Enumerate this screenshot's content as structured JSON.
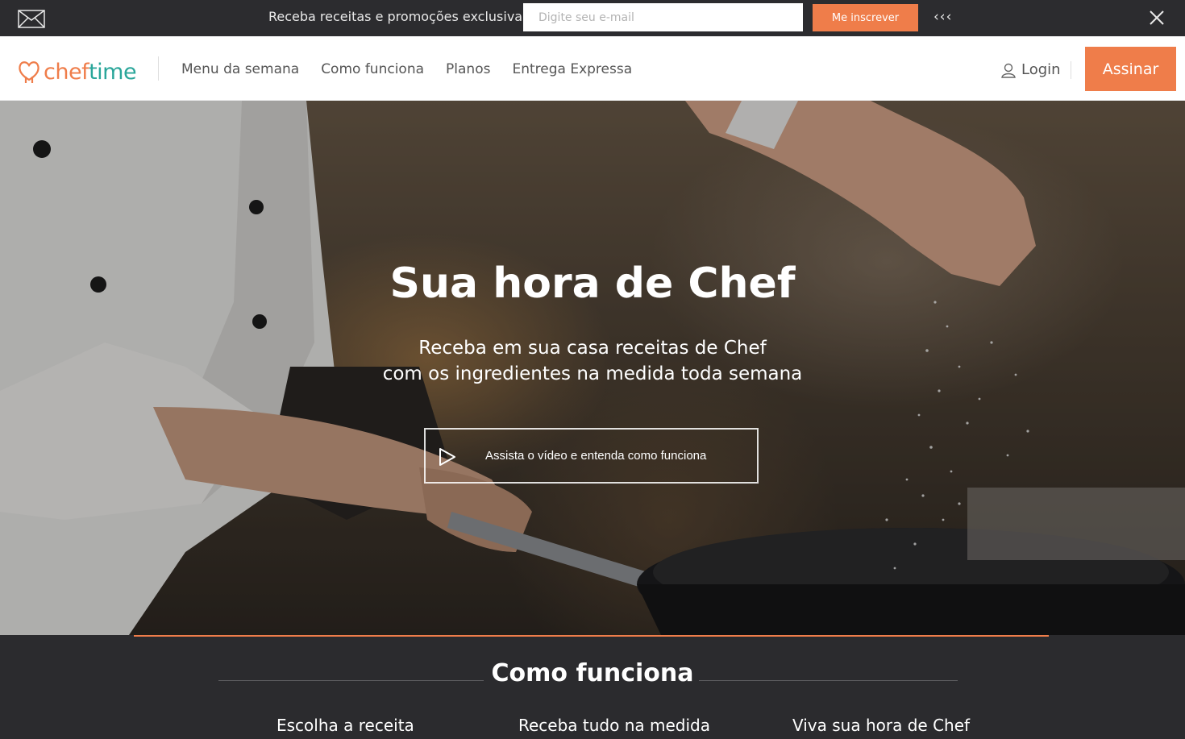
{
  "promo": {
    "icon": "envelope-icon",
    "text": "Receba receitas e promoções exclusivas",
    "email_placeholder": "Digite seu e-mail",
    "email_value": "",
    "subscribe_label": "Me inscrever",
    "collapse_label": "‹‹‹",
    "close_icon": "close-icon"
  },
  "header": {
    "logo": {
      "part1": "chef",
      "part2": "time",
      "icon": "chef-hat-heart-icon"
    },
    "nav": [
      "Menu da semana",
      "Como funciona",
      "Planos",
      "Entrega Expressa"
    ],
    "login_label": "Login",
    "login_icon": "user-icon",
    "cta_label": "Assinar"
  },
  "hero": {
    "title": "Sua hora de Chef",
    "subtitle_line1": "Receba em sua casa receitas de Chef",
    "subtitle_line2": "com os ingredientes na medida toda semana",
    "video_label": "Assista o vídeo e entenda como funciona",
    "video_icon": "play-icon"
  },
  "section": {
    "title": "Como funciona",
    "steps": [
      "Escolha a receita",
      "Receba tudo na medida",
      "Viva sua hora de Chef"
    ]
  },
  "colors": {
    "accent": "#ef7d4a",
    "logo_teal": "#2aa69a",
    "dark_bar": "#2c2c2f"
  }
}
